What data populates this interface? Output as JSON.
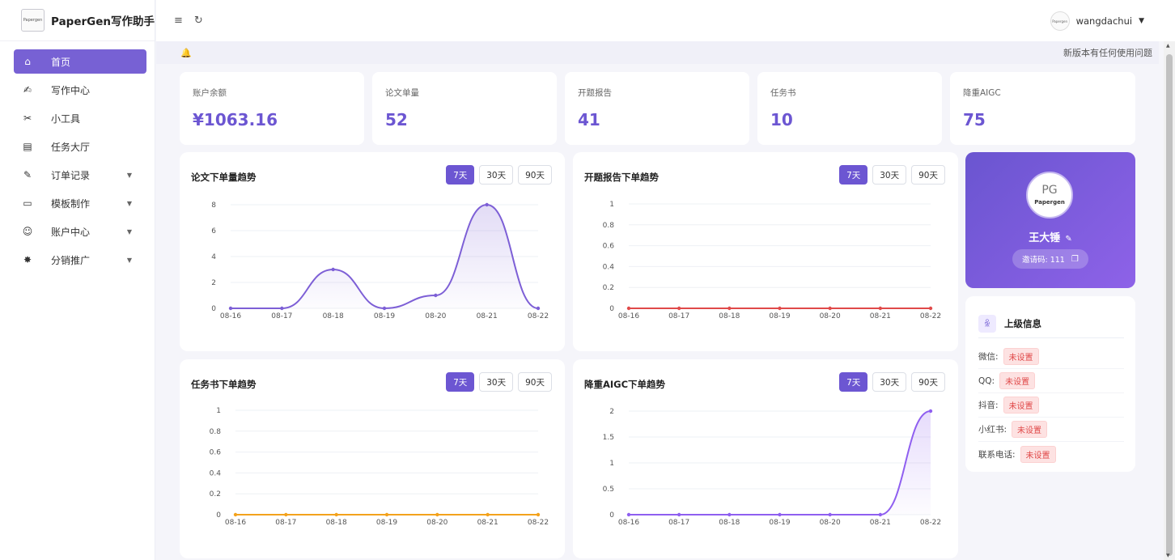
{
  "brand": {
    "logo_text": "Papergen",
    "title": "PaperGen写作助手"
  },
  "menu": [
    {
      "label": "首页",
      "icon": "home-icon",
      "glyph": "⌂",
      "active": true,
      "arrow": false
    },
    {
      "label": "写作中心",
      "icon": "pen-icon",
      "glyph": "✍",
      "active": false,
      "arrow": false
    },
    {
      "label": "小工具",
      "icon": "tools-icon",
      "glyph": "✂",
      "active": false,
      "arrow": false
    },
    {
      "label": "任务大厅",
      "icon": "clipboard-icon",
      "glyph": "▤",
      "active": false,
      "arrow": false
    },
    {
      "label": "订单记录",
      "icon": "order-icon",
      "glyph": "✎",
      "active": false,
      "arrow": true
    },
    {
      "label": "模板制作",
      "icon": "template-icon",
      "glyph": "▭",
      "active": false,
      "arrow": true
    },
    {
      "label": "账户中心",
      "icon": "user-icon",
      "glyph": "☺",
      "active": false,
      "arrow": true
    },
    {
      "label": "分销推广",
      "icon": "star-icon",
      "glyph": "✸",
      "active": false,
      "arrow": true
    }
  ],
  "topbar": {
    "menu_icon": "≡",
    "refresh_icon": "↻",
    "user": {
      "name": "wangdachui",
      "arrow": "▼",
      "avatar_text": "Papergen"
    }
  },
  "notice": {
    "bell": "🔔",
    "text": "新版本有任何使用问题"
  },
  "stats": [
    {
      "label": "账户余额",
      "value": "¥1063.16"
    },
    {
      "label": "论文单量",
      "value": "52"
    },
    {
      "label": "开题报告",
      "value": "41"
    },
    {
      "label": "任务书",
      "value": "10"
    },
    {
      "label": "降重AIGC",
      "value": "75"
    }
  ],
  "range_buttons": [
    "7天",
    "30天",
    "90天"
  ],
  "chart_data": [
    {
      "type": "line",
      "title": "论文下单量趋势",
      "x": [
        "08-16",
        "08-17",
        "08-18",
        "08-19",
        "08-20",
        "08-21",
        "08-22"
      ],
      "y": [
        0,
        0,
        3,
        0,
        1,
        8,
        0
      ],
      "ylim": [
        0,
        8
      ],
      "yticks": [
        0,
        2,
        4,
        6,
        8
      ],
      "color": "#7d5fd6",
      "area": true,
      "smooth": true
    },
    {
      "type": "line",
      "title": "开题报告下单趋势",
      "x": [
        "08-16",
        "08-17",
        "08-18",
        "08-19",
        "08-20",
        "08-21",
        "08-22"
      ],
      "y": [
        0,
        0,
        0,
        0,
        0,
        0,
        0
      ],
      "ylim": [
        0,
        1
      ],
      "yticks": [
        0,
        0.2,
        0.4,
        0.6,
        0.8,
        1
      ],
      "color": "#e04a4a",
      "area": false,
      "smooth": false
    },
    {
      "type": "line",
      "title": "任务书下单趋势",
      "x": [
        "08-16",
        "08-17",
        "08-18",
        "08-19",
        "08-20",
        "08-21",
        "08-22"
      ],
      "y": [
        0,
        0,
        0,
        0,
        0,
        0,
        0
      ],
      "ylim": [
        0,
        1
      ],
      "yticks": [
        0,
        0.2,
        0.4,
        0.6,
        0.8,
        1
      ],
      "color": "#f3a21c",
      "area": false,
      "smooth": false
    },
    {
      "type": "line",
      "title": "降重AIGC下单趋势",
      "x": [
        "08-16",
        "08-17",
        "08-18",
        "08-19",
        "08-20",
        "08-21",
        "08-22"
      ],
      "y": [
        0,
        0,
        0,
        0,
        0,
        0,
        2
      ],
      "ylim": [
        0,
        2
      ],
      "yticks": [
        0,
        0.5,
        1,
        1.5,
        2
      ],
      "color": "#8f5ff0",
      "area": true,
      "smooth": true
    }
  ],
  "profile": {
    "avatar_text": "Papergen",
    "avatar_mark": "PG",
    "name": "王大锤",
    "edit_icon": "✎",
    "invite_label": "邀请码: 111",
    "copy_icon": "❐"
  },
  "superior": {
    "title": "上级信息",
    "icon": "ꆜ",
    "rows": [
      {
        "label": "微信:",
        "value": "未设置"
      },
      {
        "label": "QQ:",
        "value": "未设置"
      },
      {
        "label": "抖音:",
        "value": "未设置"
      },
      {
        "label": "小红书:",
        "value": "未设置"
      },
      {
        "label": "联系电话:",
        "value": "未设置"
      }
    ]
  }
}
